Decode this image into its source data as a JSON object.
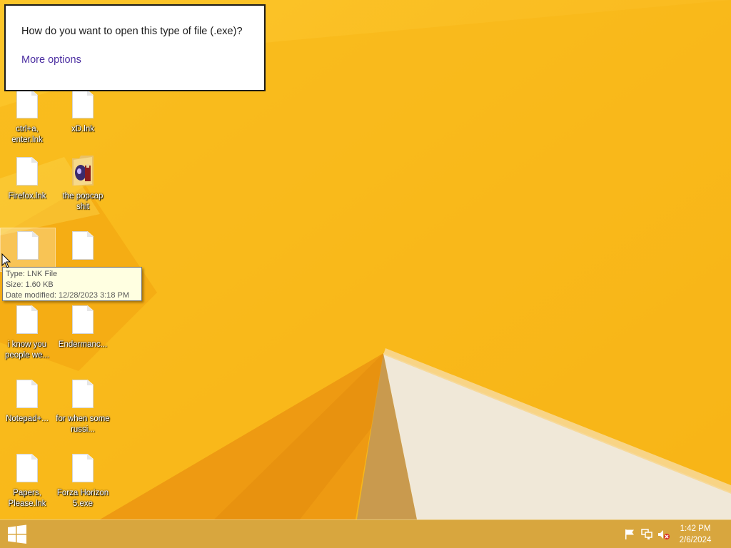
{
  "open_with": {
    "question": "How do you want to open this type of file (.exe)?",
    "more_options": "More options"
  },
  "desktop_icons": [
    {
      "label": "ctrl+a, enter.lnk",
      "type": "document"
    },
    {
      "label": "xD.lnk",
      "type": "document"
    },
    {
      "label": "Firefox.lnk",
      "type": "document"
    },
    {
      "label": "the popcap shit",
      "type": "folder"
    },
    {
      "label": "",
      "type": "document"
    },
    {
      "label": "",
      "type": "document"
    },
    {
      "label": "i know you people we...",
      "type": "document"
    },
    {
      "label": "Endermanc...",
      "type": "document"
    },
    {
      "label": "Notepad+...",
      "type": "document"
    },
    {
      "label": "for when some russi...",
      "type": "document"
    },
    {
      "label": "Papers, Please.lnk",
      "type": "document"
    },
    {
      "label": "Forza Horizon 5.exe",
      "type": "document"
    }
  ],
  "tooltip": {
    "type_line": "Type: LNK File",
    "size_line": "Size: 1.60 KB",
    "date_line": "Date modified: 12/28/2023 3:18 PM"
  },
  "taskbar": {
    "start_icon": "windows-logo-icon",
    "tray_icons": [
      "flag-icon",
      "network-icon",
      "speaker-muted-icon"
    ],
    "clock_time": "1:42 PM",
    "clock_date": "2/6/2024"
  },
  "colors": {
    "wallpaper_base": "#f9b91a",
    "taskbar": "#d8a63e",
    "link_purple": "#4b2ea1",
    "tooltip_bg": "#ffffe1"
  }
}
